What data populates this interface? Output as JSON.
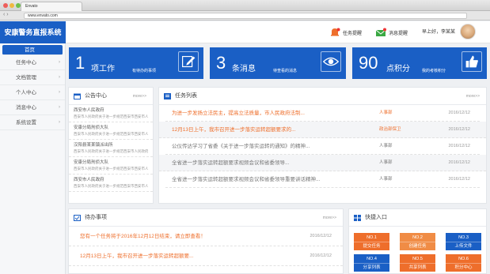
{
  "browser": {
    "tab_title": "Envato",
    "url": "www.envato.com"
  },
  "header": {
    "logo": "安康警务直报系统",
    "task_alert": "任务提醒",
    "msg_alert": "消息提醒",
    "greeting": "早上好，李某某"
  },
  "sidebar": {
    "items": [
      {
        "label": "首页"
      },
      {
        "label": "任务中心"
      },
      {
        "label": "文档管理"
      },
      {
        "label": "个人中心"
      },
      {
        "label": "消息中心"
      },
      {
        "label": "系统设置"
      }
    ]
  },
  "stats": [
    {
      "num": "1",
      "unit": "项工作",
      "sub": "有待办的事项",
      "icon": "edit-icon"
    },
    {
      "num": "3",
      "unit": "条消息",
      "sub": "待查看的消息",
      "icon": "eye-icon"
    },
    {
      "num": "90",
      "unit": "点积分",
      "sub": "我的考核积分",
      "icon": "thumbs-up-icon"
    }
  ],
  "notice": {
    "title": "公告中心",
    "more": "more>>",
    "items": [
      {
        "title": "西安市人民政府",
        "desc": "西安市人民政府关于进一步规范西安市西安市人民政府关于进一步规范"
      },
      {
        "title": "安康分局刑侦大队",
        "desc": "西安市人民政府关于进一步规范西安市西安市人民政府"
      },
      {
        "title": "汉阳县某某镇派出所",
        "desc": "西安市人民政府关于进一步规范西安市人民政府..."
      },
      {
        "title": "安康分局刑侦大队",
        "desc": "西安市人民政府关于进一步规范西安市西安市人民政府"
      },
      {
        "title": "西安市人民政府",
        "desc": "西安市人民政府关于进一步规范西安市西安市人民政府"
      }
    ]
  },
  "tasks": {
    "title": "任务列表",
    "more": "more>>",
    "rows": [
      {
        "title": "为进一步发扬立法民主，提高立法质量，市人民政府法制...",
        "dept": "人事部",
        "date": "2016/12/12"
      },
      {
        "title": "12月13日上午，我市召开进一步落实运转超额要求的...",
        "dept": "政治部保卫",
        "date": "2016/12/12"
      },
      {
        "title": "公仪传达学习了省委《关于进一步落实运转的通知》的精神...",
        "dept": "人事部",
        "date": "2016/12/12"
      },
      {
        "title": "全省进一步落实运转超额要求视频会议和省委领导...",
        "dept": "人事部",
        "date": "2016/12/12"
      },
      {
        "title": "全省进一步落实运转超额要求视频会议和省委领导重要讲话精神...",
        "dept": "人事部",
        "date": "2016/12/12"
      }
    ]
  },
  "todo": {
    "title": "待办事项",
    "more": "more>>",
    "rows": [
      {
        "title": "您有一个任务将于2016年12月12日结束，请立即查看！",
        "date": "2016/12/12"
      },
      {
        "title": "12月13日上午，我市召开进一步落实运转超额要...",
        "date": "2016/12/12"
      }
    ]
  },
  "quick": {
    "title": "快捷入口",
    "buttons": [
      {
        "no": "NO.1",
        "label": "提交任务",
        "color": "#ee6e2b"
      },
      {
        "no": "NO.2",
        "label": "创建任务",
        "color": "#f08c45"
      },
      {
        "no": "NO.3",
        "label": "上传文件",
        "color": "#1a5fc5"
      },
      {
        "no": "NO.4",
        "label": "分享列表",
        "color": "#1a5fc5"
      },
      {
        "no": "NO.5",
        "label": "共享列表",
        "color": "#ee6e2b"
      },
      {
        "no": "NO.6",
        "label": "积分中心",
        "color": "#ee6e2b"
      }
    ]
  }
}
